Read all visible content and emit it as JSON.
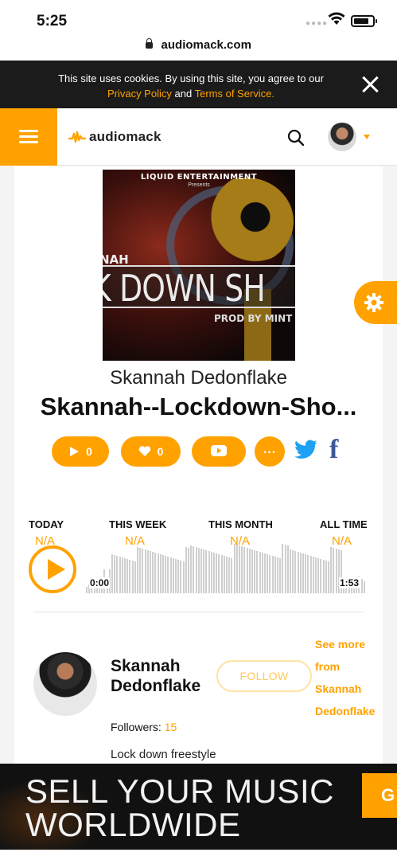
{
  "status_bar": {
    "time": "5:25"
  },
  "browser": {
    "url": "audiomack.com"
  },
  "cookie_banner": {
    "text_before": "This site uses cookies. By using this site, you agree to our",
    "privacy_link": "Privacy Policy",
    "and": "and",
    "terms_link": "Terms of Service",
    "period": "."
  },
  "header": {
    "brand": "audiomack",
    "accent_color": "#ffa200"
  },
  "cover_art": {
    "top_text": "LIQUID ENTERTAINMENT",
    "presents": "Presents",
    "name_fragment": "NAH",
    "big_text": "K DOWN SH",
    "prod_text": "PROD BY MINT"
  },
  "song": {
    "artist": "Skannah Dedonflake",
    "title": "Skannah--Lockdown-Sho..."
  },
  "actions": {
    "plays": "0",
    "favorites": "0",
    "more": "..."
  },
  "stats": {
    "today_label": "TODAY",
    "today_value": "N/A",
    "week_label": "THIS WEEK",
    "week_value": "N/A",
    "month_label": "THIS MONTH",
    "month_value": "N/A",
    "all_label": "ALL TIME",
    "all_value": "N/A"
  },
  "player": {
    "current_time": "0:00",
    "duration": "1:53"
  },
  "artist_section": {
    "name": "Skannah Dedonflake",
    "follow_label": "FOLLOW",
    "see_more": "See more from Skannah Dedonflake",
    "followers_label": "Followers:",
    "followers_count": "15",
    "description": "Lock down freestyle"
  },
  "ad": {
    "line1": "SELL YOUR MUSIC",
    "line2": "WORLDWIDE",
    "cta": "G"
  }
}
